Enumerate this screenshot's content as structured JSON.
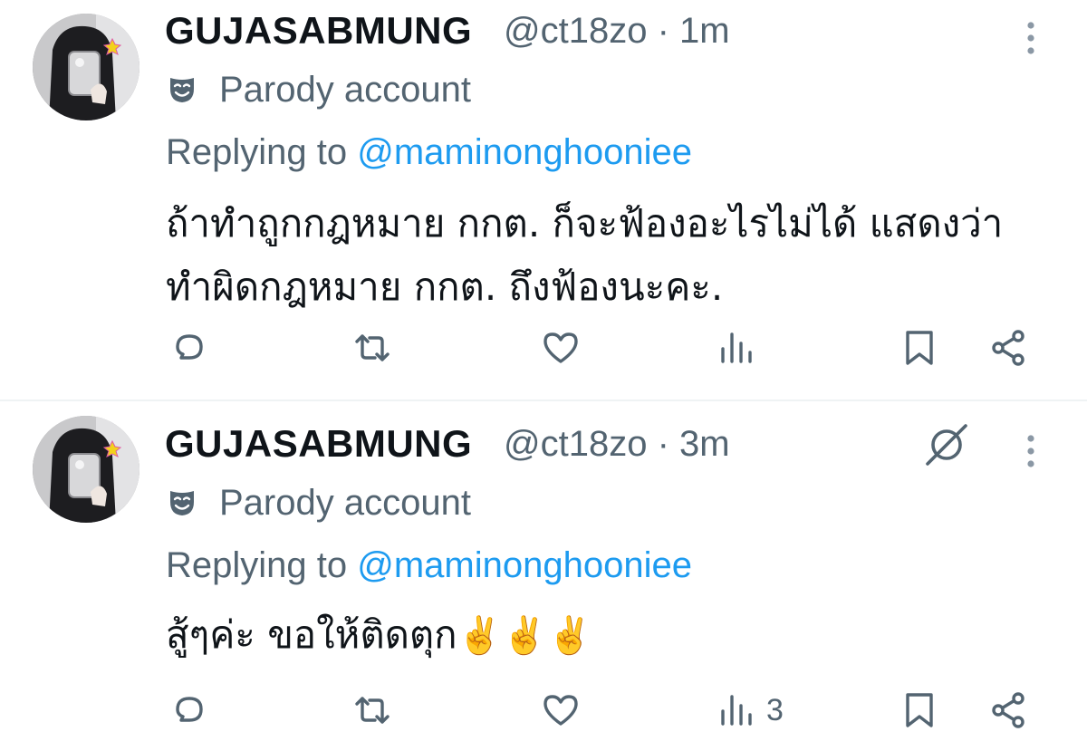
{
  "tweets": [
    {
      "display_name": "GUJASABMUNG",
      "handle_time": "@ct18zo · 1m",
      "label": "Parody account",
      "replying_prefix": "Replying to ",
      "replying_to": "@maminonghooniee",
      "text_line1": "ถ้าทำถูกกฎหมาย กกต. ก็จะฟ้องอะไรไม่ได้ แสดงว่า",
      "text_line2": "ทำผิดกฎหมาย กกต. ถึงฟ้องนะคะ.",
      "views_count": ""
    },
    {
      "display_name": "GUJASABMUNG",
      "handle_time": "@ct18zo · 3m",
      "label": "Parody account",
      "replying_prefix": "Replying to ",
      "replying_to": "@maminonghooniee",
      "text": "สู้ๆค่ะ ขอให้ติดตุก",
      "emoji": "✌️✌️✌️",
      "views_count": "3"
    }
  ],
  "icons": {
    "reply": "reply-icon",
    "repost": "repost-icon",
    "like": "heart-icon",
    "views": "views-icon",
    "bookmark": "bookmark-icon",
    "share": "share-icon",
    "more": "more-vertical-icon",
    "grok": "grok-icon",
    "parody": "mask-icon"
  },
  "colors": {
    "text": "#0f1419",
    "secondary": "#536471",
    "link": "#1d9bf0",
    "divider": "#eff3f4"
  }
}
